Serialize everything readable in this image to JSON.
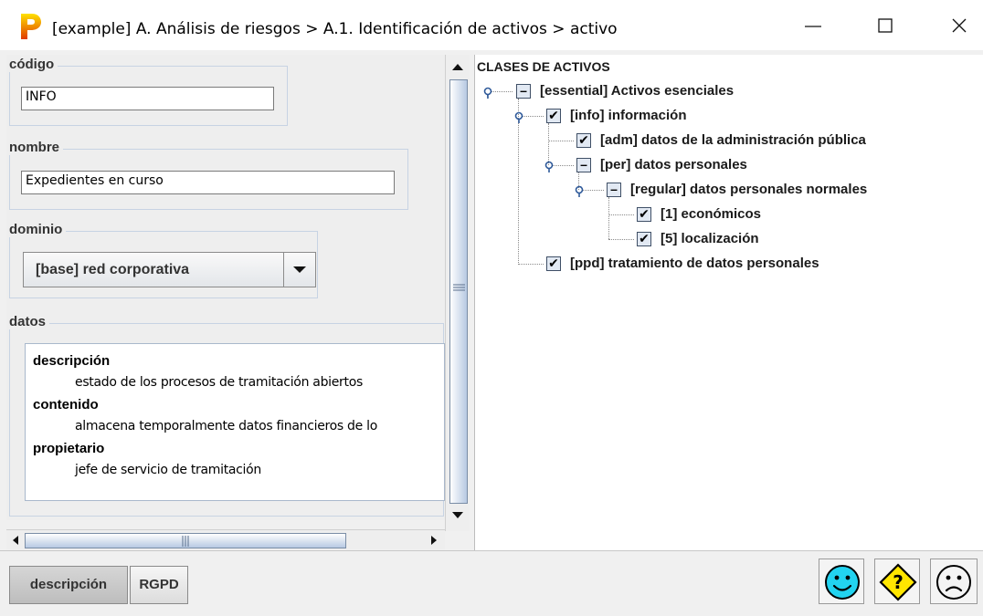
{
  "window": {
    "title": "[example] A. Análisis de riesgos > A.1. Identificación de activos > activo",
    "minimize_label": "—",
    "maximize_label": "☐",
    "close_label": "✕"
  },
  "form": {
    "codigo": {
      "legend": "código",
      "value": "INFO"
    },
    "nombre": {
      "legend": "nombre",
      "value": "Expedientes en curso"
    },
    "dominio": {
      "legend": "dominio",
      "value": "[base] red corporativa"
    },
    "datos": {
      "legend": "datos",
      "lines": [
        {
          "key": "descripción",
          "value": "estado de los procesos de tramitación abiertos"
        },
        {
          "key": "contenido",
          "value": "almacena temporalmente datos financieros de lo"
        },
        {
          "key": "propietario",
          "value": "jefe de servicio de tramitación"
        }
      ]
    }
  },
  "tree": {
    "root": "CLASES DE ACTIVOS",
    "nodes": [
      {
        "label": "[essential] Activos esenciales",
        "state": "partial"
      },
      {
        "label": "[info] información",
        "state": "checked"
      },
      {
        "label": "[adm] datos de la administración pública",
        "state": "checked"
      },
      {
        "label": "[per] datos personales",
        "state": "partial"
      },
      {
        "label": "[regular] datos personales normales",
        "state": "partial"
      },
      {
        "label": "[1] económicos",
        "state": "checked"
      },
      {
        "label": "[5] localización",
        "state": "checked"
      },
      {
        "label": "[ppd] tratamiento de datos personales",
        "state": "checked"
      }
    ],
    "check_glyph": "✔",
    "partial_glyph": "–"
  },
  "bottom": {
    "tabs": [
      {
        "label": "descripción",
        "active": true
      },
      {
        "label": "RGPD",
        "active": false
      }
    ],
    "buttons": [
      "happy-face-icon",
      "question-diamond-icon",
      "sad-face-icon"
    ]
  },
  "colors": {
    "smiley_fill": "#22d3f0",
    "question_fill": "#ffe600",
    "scroll_thumb": "#b7c9e2"
  }
}
